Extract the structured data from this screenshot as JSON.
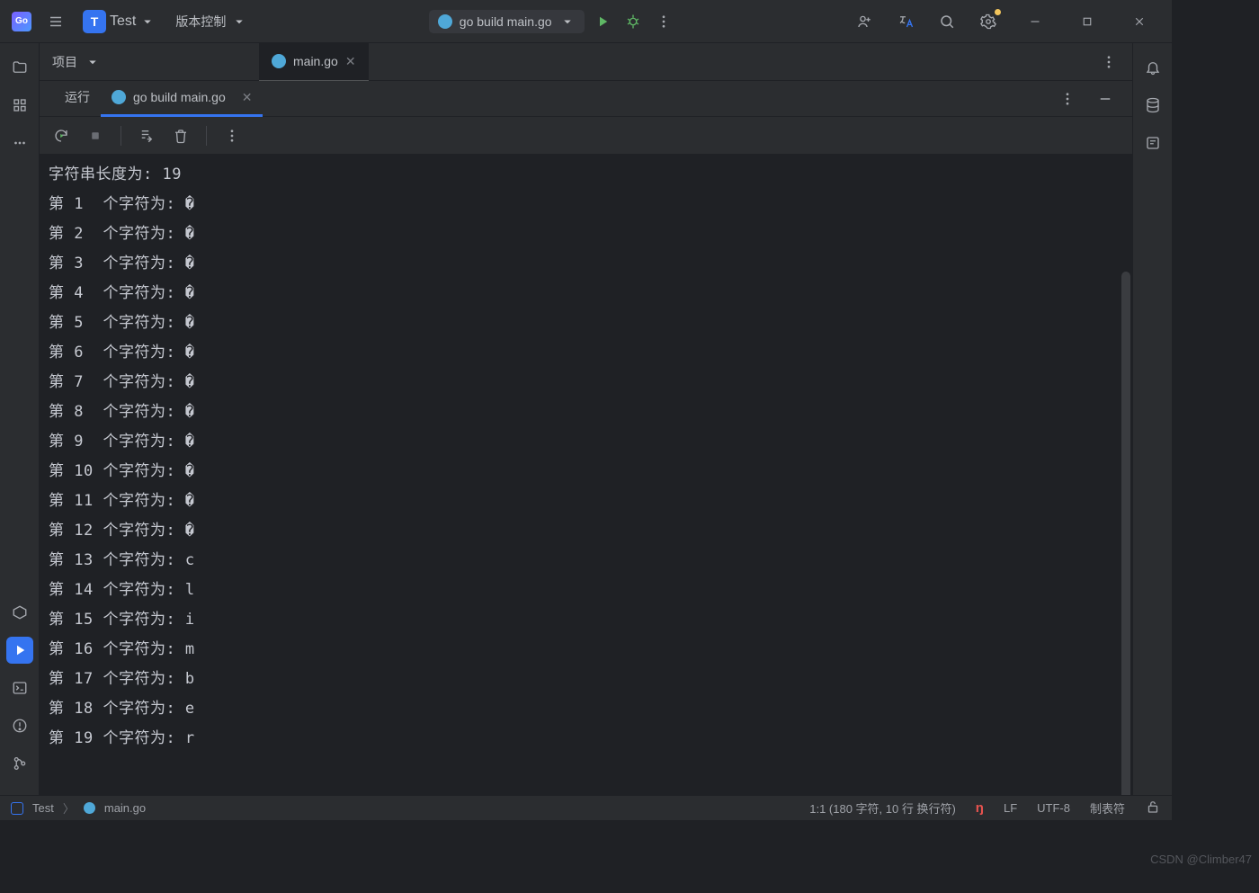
{
  "titlebar": {
    "project_initial": "T",
    "project_name": "Test",
    "vcs_label": "版本控制",
    "run_config": "go build main.go"
  },
  "editor_tabs": {
    "project_label": "项目",
    "active_file": "main.go"
  },
  "run_panel": {
    "tab_run": "运行",
    "tab_config": "go build main.go"
  },
  "console": {
    "length_line": "字符串长度为: 19",
    "lines": [
      {
        "n": "1",
        "v": "�"
      },
      {
        "n": "2",
        "v": "�"
      },
      {
        "n": "3",
        "v": "�"
      },
      {
        "n": "4",
        "v": "�"
      },
      {
        "n": "5",
        "v": "�"
      },
      {
        "n": "6",
        "v": "�"
      },
      {
        "n": "7",
        "v": "�"
      },
      {
        "n": "8",
        "v": "�"
      },
      {
        "n": "9",
        "v": "�"
      },
      {
        "n": "10",
        "v": "�"
      },
      {
        "n": "11",
        "v": "�"
      },
      {
        "n": "12",
        "v": "�"
      },
      {
        "n": "13",
        "v": "c"
      },
      {
        "n": "14",
        "v": "l"
      },
      {
        "n": "15",
        "v": "i"
      },
      {
        "n": "16",
        "v": "m"
      },
      {
        "n": "17",
        "v": "b"
      },
      {
        "n": "18",
        "v": "e"
      },
      {
        "n": "19",
        "v": "r"
      }
    ]
  },
  "statusbar": {
    "crumb_root": "Test",
    "crumb_file": "main.go",
    "position": "1:1 (180 字符, 10 行 换行符)",
    "line_sep": "LF",
    "encoding": "UTF-8",
    "indent": "制表符"
  },
  "watermark": "CSDN @Climber47"
}
